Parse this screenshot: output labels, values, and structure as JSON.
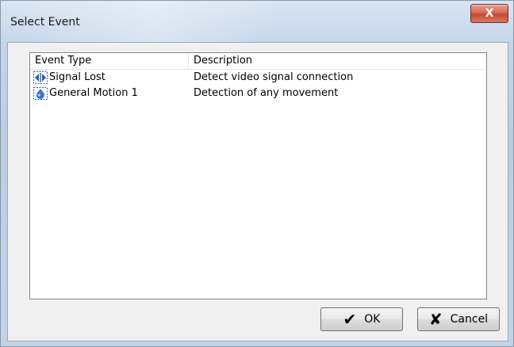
{
  "window": {
    "title": "Select Event",
    "close_label": "X"
  },
  "list": {
    "headers": {
      "type": "Event Type",
      "description": "Description"
    },
    "rows": [
      {
        "type": "Signal Lost",
        "description": "Detect video signal connection",
        "icon": "signal-lost-icon"
      },
      {
        "type": "General Motion 1",
        "description": "Detection of any movement",
        "icon": "motion-icon"
      }
    ]
  },
  "buttons": {
    "ok_label": "OK",
    "cancel_label": "Cancel"
  }
}
